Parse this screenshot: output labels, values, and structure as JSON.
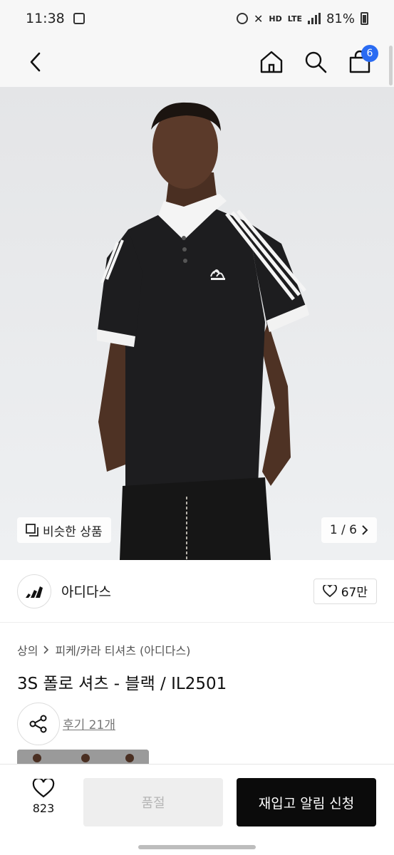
{
  "status": {
    "time": "11:38",
    "battery": "81%",
    "network_hd": "HD",
    "network_lte": "LTE"
  },
  "nav": {
    "cart_count": "6"
  },
  "hero": {
    "similar_label": "비슷한 상품",
    "pager": "1 / 6"
  },
  "brand": {
    "name": "아디다스",
    "likes": "67만"
  },
  "breadcrumb": {
    "level1": "상의",
    "level2": "피케/카라 티셔츠 (아디다스)"
  },
  "product": {
    "title": "3S 폴로 셔츠 - 블랙 / IL2501",
    "reviews": "후기 21개"
  },
  "bottom": {
    "wish_count": "823",
    "soldout_label": "품절",
    "restock_label": "재입고 알림 신청"
  },
  "colors": {
    "accent": "#2a6bf2",
    "primary_button": "#0b0b0b",
    "disabled_button": "#eeeeee"
  },
  "icons": [
    "back-icon",
    "home-icon",
    "search-icon",
    "cart-icon",
    "copy-icon",
    "chevron-right-icon",
    "heart-icon",
    "share-icon",
    "adidas-logo"
  ]
}
